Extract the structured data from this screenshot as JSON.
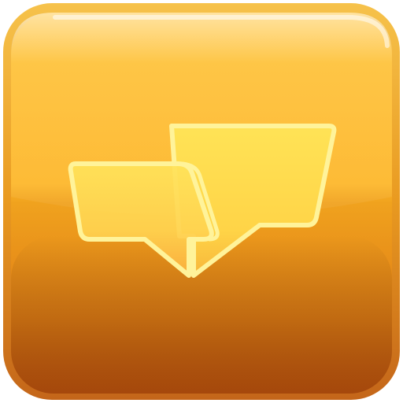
{
  "icon": {
    "name": "chat-bubbles-icon",
    "description_kind": "app-icon",
    "colors": {
      "frame_outer": "#E8A21E",
      "frame_inner_top": "#FFC12F",
      "frame_inner_bottom": "#D46E12",
      "bottom_shadow": "#B45A12",
      "gloss": "#FFFFFF",
      "bubble_fill": "#FFE14D",
      "bubble_fill_transparent": "#FFE97A",
      "bubble_stroke": "#FFF6A6"
    }
  }
}
